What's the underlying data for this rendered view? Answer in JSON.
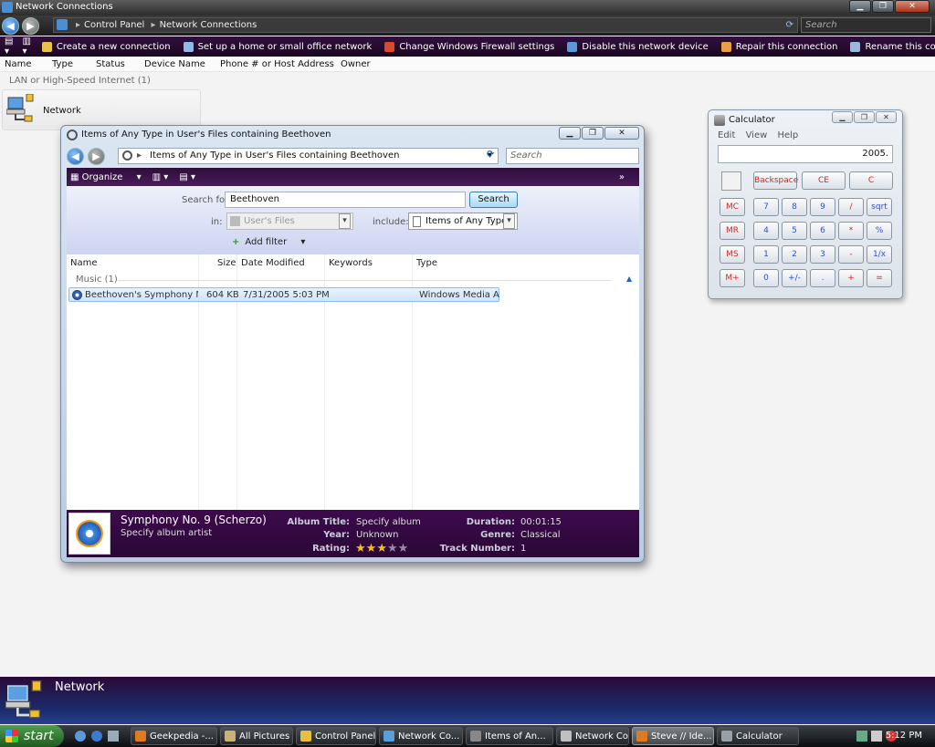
{
  "main_window": {
    "title": "Network Connections",
    "breadcrumb": [
      "Control Panel",
      "Network Connections"
    ],
    "search_placeholder": "Search",
    "commands": [
      {
        "label": "Create a new connection",
        "color": "#e8c24a"
      },
      {
        "label": "Set up a home or small office network",
        "color": "#8fb9e8"
      },
      {
        "label": "Change Windows Firewall settings",
        "color": "#d94a2a"
      },
      {
        "label": "Disable this network device",
        "color": "#5a9ad8"
      },
      {
        "label": "Repair this connection",
        "color": "#e8a040"
      },
      {
        "label": "Rename this connection",
        "color": "#9ab8e0"
      }
    ],
    "columns": [
      "Name",
      "Type",
      "Status",
      "Device Name",
      "Phone # or Host Address",
      "Owner"
    ],
    "group_label": "LAN or High-Speed Internet (1)",
    "item": "Network",
    "details_name": "Network"
  },
  "search_window": {
    "title": "Items of Any Type in User's Files containing Beethoven",
    "breadcrumb": "Items of Any Type in User's Files containing Beethoven",
    "search_placeholder": "Search",
    "commands": [
      "Organize",
      "Views",
      "Layout"
    ],
    "search_for_label": "Search for:",
    "search_term": "Beethoven",
    "search_button": "Search",
    "in_label": "in:",
    "location": "User's Files",
    "include_label": "include:",
    "type_filter": "Items of Any Type",
    "add_filter": "Add filter",
    "columns": [
      "Name",
      "Size",
      "Date Modified",
      "Keywords",
      "Type"
    ],
    "group": "Music (1)",
    "row": {
      "name": "Beethoven's Symphony No...",
      "size": "604 KB",
      "date": "7/31/2005 5:03 PM",
      "keywords": "",
      "type": "Windows Media A..."
    },
    "details": {
      "title": "Symphony No. 9 (Scherzo)",
      "artist": "Specify album artist",
      "album_title_label": "Album Title:",
      "album_title": "Specify album",
      "year_label": "Year:",
      "year": "Unknown",
      "rating_label": "Rating:",
      "rating": 3,
      "rating_max": 5,
      "duration_label": "Duration:",
      "duration": "00:01:15",
      "genre_label": "Genre:",
      "genre": "Classical",
      "track_label": "Track Number:",
      "track": "1"
    }
  },
  "calculator": {
    "title": "Calculator",
    "menu": [
      "Edit",
      "View",
      "Help"
    ],
    "display": "2005.",
    "top_row": [
      "Backspace",
      "CE",
      "C"
    ],
    "rows": [
      [
        "MC",
        "7",
        "8",
        "9",
        "/",
        "sqrt"
      ],
      [
        "MR",
        "4",
        "5",
        "6",
        "*",
        "%"
      ],
      [
        "MS",
        "1",
        "2",
        "3",
        "-",
        "1/x"
      ],
      [
        "M+",
        "0",
        "+/-",
        ".",
        "+",
        "="
      ]
    ]
  },
  "taskbar": {
    "start": "start",
    "items": [
      {
        "label": "Geekpedia -...",
        "color": "#e07a20"
      },
      {
        "label": "All Pictures ...",
        "color": "#c9b27a"
      },
      {
        "label": "Control Panel",
        "color": "#e6c040"
      },
      {
        "label": "Network Co...",
        "color": "#5aa0d8"
      },
      {
        "label": "Items of An...",
        "color": "#888888"
      },
      {
        "label": "Network Co...",
        "color": "#c0c0c0"
      },
      {
        "label": "Steve // Ide...",
        "color": "#e07a20"
      },
      {
        "label": "Calculator",
        "color": "#9aa0a8"
      }
    ],
    "active_index": 6,
    "clock": "5:12 PM"
  }
}
